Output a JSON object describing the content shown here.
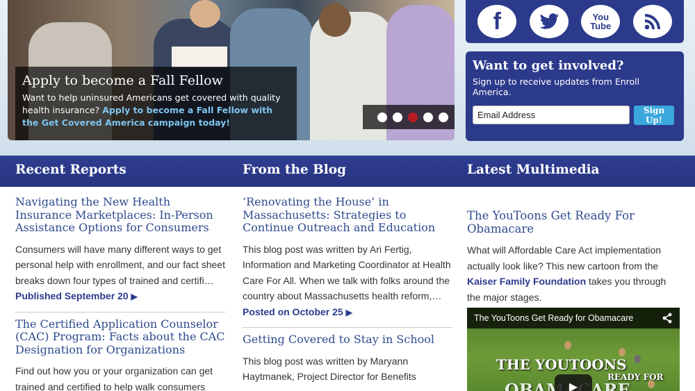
{
  "hero": {
    "title": "Apply to become a Fall Fellow",
    "text": "Want to help uninsured Americans get covered with quality health insurance?",
    "link": "Apply to become a Fall Fellow with the Get Covered America campaign today!",
    "active_slide": 3,
    "slide_count": 5
  },
  "social": {
    "facebook": "f",
    "youtube": "You Tube"
  },
  "signup": {
    "title": "Want to get involved?",
    "subtitle": "Sign up to receive updates from Enroll America.",
    "placeholder": "Email Address",
    "button": "Sign Up!"
  },
  "sections": {
    "reports": "Recent Reports",
    "blog": "From the Blog",
    "multimedia": "Latest Multimedia"
  },
  "reports": [
    {
      "title": "Navigating the New Health Insurance Marketplaces: In-Person Assistance Options for Consumers",
      "body": "Consumers will have many different ways to get personal help with enrollment, and our fact sheet breaks down four types of trained and certifi…",
      "meta": "Published September 20"
    },
    {
      "title": "The Certified Application Counselor (CAC) Program: Facts about the CAC Designation for Organizations",
      "body": "Find out how you or your organization can get trained and certified to help walk consumers"
    }
  ],
  "blog": [
    {
      "title": "‘Renovating the House’ in Massachusetts: Strategies to Continue Outreach and Education",
      "body": "This blog post was written by Ari Fertig, Information and Marketing Coordinator at Health Care For All. When we talk with folks around the country about Massachusetts health reform,…",
      "meta": "Posted on October 25"
    },
    {
      "title": "Getting Covered to Stay in School",
      "body": "This blog post was written by Maryann Haytmanek, Project Director for Benefits"
    }
  ],
  "multimedia": {
    "title": "The YouToons Get Ready For Obamacare",
    "body_before": "What will Affordable Care Act implementation actually look like? This new cartoon from the",
    "link": "Kaiser Family Foundation",
    "body_after": "takes you through the major stages.",
    "video_title": "The YouToons Get Ready for Obamacare",
    "overlay_line1": "THE YOUTOONS",
    "overlay_line2": "READY FOR",
    "overlay_line3": "OBAMACARE"
  },
  "colors": {
    "brand_blue": "#2c3a8c",
    "link_blue": "#2e4b8f",
    "accent_cyan": "#3aa8dc",
    "active_dot": "#b81c22"
  }
}
